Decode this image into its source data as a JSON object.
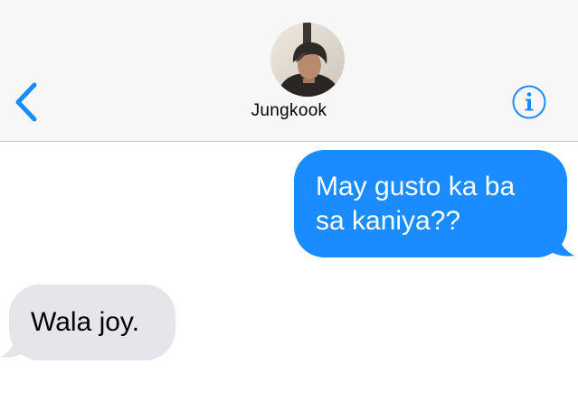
{
  "header": {
    "contact_name": "Jungkook",
    "back_icon": "chevron-left-icon",
    "info_icon": "info-icon",
    "avatar": "contact-avatar-photo"
  },
  "colors": {
    "accent": "#1a8cff",
    "sent_bubble": "#1a8cff",
    "received_bubble": "#e5e5ea",
    "header_bg": "#f7f7f7"
  },
  "messages": [
    {
      "direction": "sent",
      "text": "May gusto ka ba sa kaniya??"
    },
    {
      "direction": "received",
      "text": "Wala joy."
    }
  ]
}
